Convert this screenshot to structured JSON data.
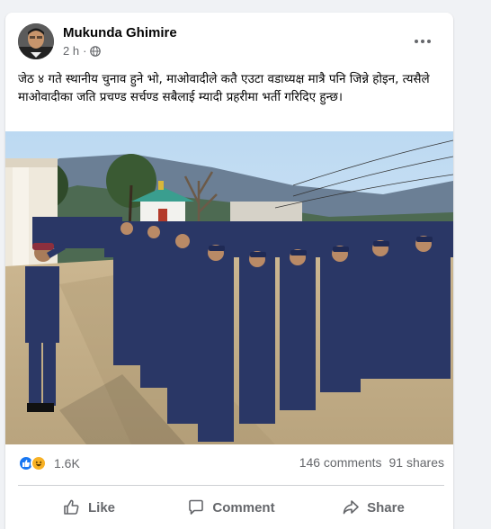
{
  "post": {
    "author": "Mukunda Ghimire",
    "time": "2 h",
    "separator": "·",
    "text": "जेठ ४ गते स्थानीय चुनाव हुने भो, माओवादीले कतै एउटा वडाध्यक्ष मात्रै पनि जिन्ने होइन, त्यसैले माओवादीका जति प्रचण्ड सर्चण्ड सबैलाई म्यादी प्रहरीमा भर्ती गरिदिए हुन्छ।"
  },
  "stats": {
    "reaction_count": "1.6K",
    "comments": "146 comments",
    "shares": "91 shares"
  },
  "actions": {
    "like": "Like",
    "comment": "Comment",
    "share": "Share"
  },
  "colors": {
    "brand_blue": "#1877f2",
    "muted_text": "#65676b",
    "uniform_navy": "#2a3766"
  },
  "icons": [
    "more-options-icon",
    "globe-icon",
    "like-reaction-icon",
    "haha-reaction-icon",
    "like-icon",
    "comment-icon",
    "share-icon"
  ]
}
